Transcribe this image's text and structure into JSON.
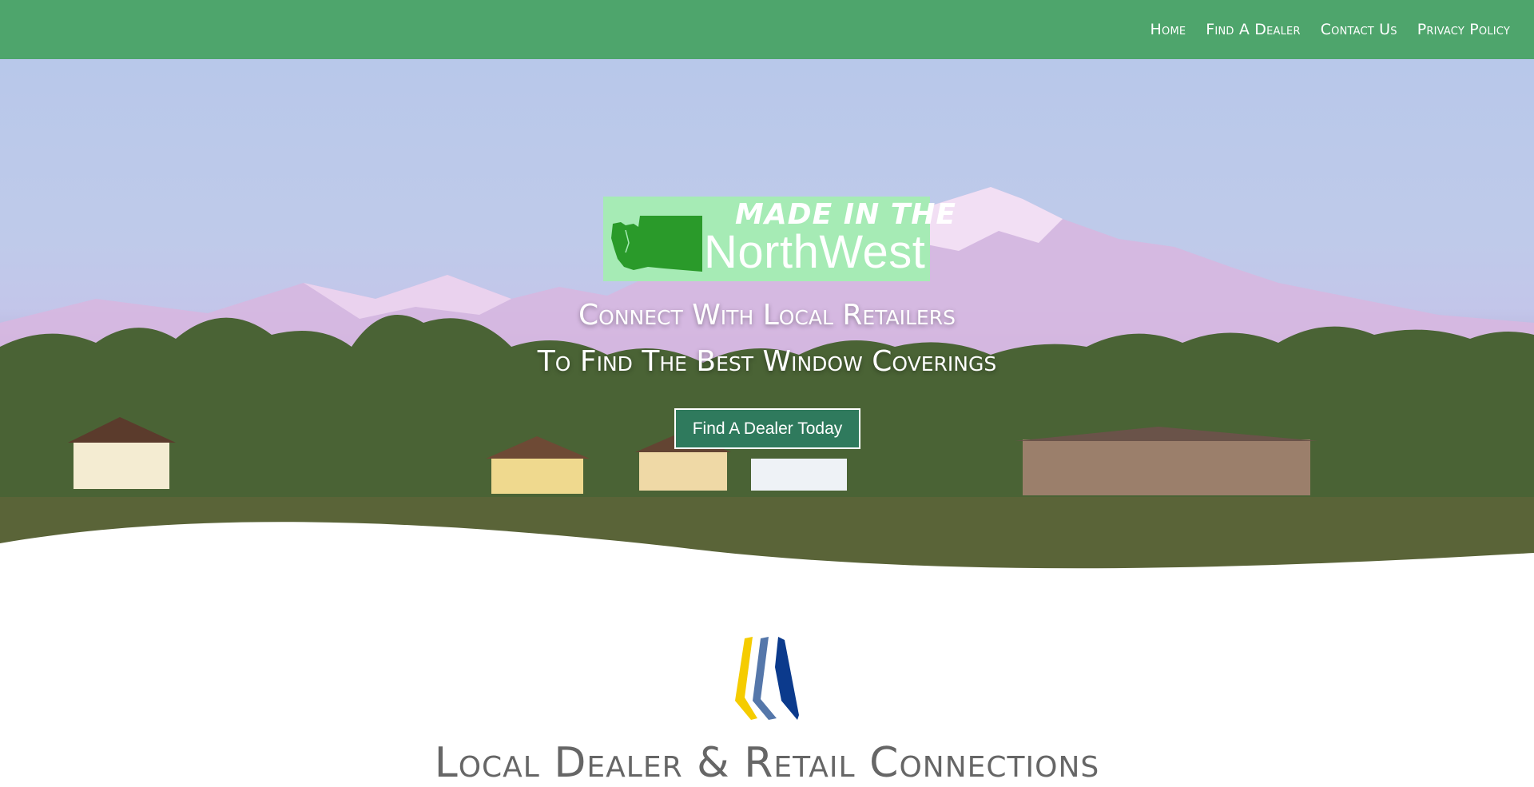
{
  "nav": {
    "items": [
      {
        "label": "Home"
      },
      {
        "label": "Find A Dealer"
      },
      {
        "label": "Contact Us"
      },
      {
        "label": "Privacy Policy"
      }
    ]
  },
  "hero": {
    "badge": {
      "line1": "MADE IN THE",
      "line2": "NorthWest"
    },
    "headline_line1": "Connect With Local Retailers",
    "headline_line2": "To Find The Best Window Coverings",
    "cta_label": "Find A Dealer Today"
  },
  "section": {
    "title": "Local Dealer & Retail Connections"
  },
  "colors": {
    "header_bg": "#4ea56c",
    "badge_bg": "#a6ebb5",
    "state_green": "#2a9a2a",
    "cta_bg": "#2f7a5d",
    "logo_yellow": "#f5cc00",
    "logo_light_blue": "#5577aa",
    "logo_dark_blue": "#0b3a8c"
  }
}
